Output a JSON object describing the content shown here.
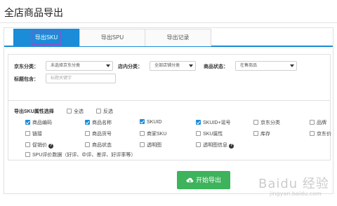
{
  "page": {
    "title": "全店商品导出"
  },
  "tabs": [
    {
      "label": "导出SKU",
      "active": true
    },
    {
      "label": "导出SPU",
      "active": false
    },
    {
      "label": "导出记录",
      "active": false
    }
  ],
  "filters": {
    "jd_category": {
      "label": "京东分类：",
      "value": "未选择京东分类"
    },
    "shop_category": {
      "label": "店内分类：",
      "value": "全部店铺分类"
    },
    "product_status": {
      "label": "商品状态：",
      "value": "在售商品"
    },
    "title_contains": {
      "label": "标题包含：",
      "placeholder": "标题关键字"
    }
  },
  "attributes": {
    "title": "导出SKU属性选择",
    "select_all": {
      "label": "全选",
      "checked": false
    },
    "invert": {
      "label": "反选",
      "checked": false
    },
    "options": [
      {
        "label": "商品编码",
        "checked": true
      },
      {
        "label": "商品名称",
        "checked": true
      },
      {
        "label": "SKUID",
        "checked": true
      },
      {
        "label": "SKUID+谣号",
        "checked": true
      },
      {
        "label": "京东分类",
        "checked": false
      },
      {
        "label": "品牌",
        "checked": false
      },
      {
        "label": "链接",
        "checked": false
      },
      {
        "label": "商品货号",
        "checked": false
      },
      {
        "label": "商家SKU",
        "checked": false
      },
      {
        "label": "SKU属性",
        "checked": false
      },
      {
        "label": "库存",
        "checked": false
      },
      {
        "label": "京东价",
        "checked": false
      },
      {
        "label": "促销价",
        "checked": false,
        "help": "?"
      },
      {
        "label": "商品状态",
        "checked": false
      },
      {
        "label": "透明图",
        "checked": false
      },
      {
        "label": "透明图信息",
        "checked": false,
        "help": "?"
      },
      {
        "label": "SPU评价数据（好评、中评、差评、好评率等）",
        "checked": false
      }
    ]
  },
  "actions": {
    "export_label": "开始导出"
  },
  "watermark": {
    "text": "Baidu 经验",
    "sub": "jingyan.baidu.com"
  },
  "colors": {
    "primary": "#1a8cd8",
    "success": "#3db35b",
    "highlight": "#8e52cf"
  }
}
